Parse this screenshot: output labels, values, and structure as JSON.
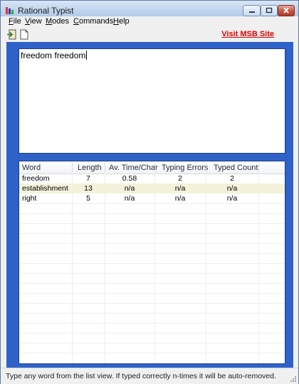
{
  "window": {
    "title": "Rational Typist"
  },
  "menu": {
    "file": {
      "first": "F",
      "rest": "ile"
    },
    "view": {
      "first": "V",
      "rest": "iew"
    },
    "modes": {
      "first": "M",
      "rest": "odes"
    },
    "commands": {
      "first": "C",
      "rest": "ommands"
    },
    "help": {
      "first": "H",
      "rest": "elp"
    }
  },
  "toolbar": {
    "icons": [
      "exit-icon",
      "new-document-icon"
    ],
    "link_label": "Visit MSB Site",
    "link_color": "#e00000"
  },
  "editor": {
    "text": "freedom freedom"
  },
  "list": {
    "columns": [
      "Word",
      "Length",
      "Av. Time/Char",
      "Typing Errors",
      "Typed Count"
    ],
    "rows": [
      [
        "freedom",
        "7",
        "0.58",
        "2",
        "2"
      ],
      [
        "establishment",
        "13",
        "n/a",
        "n/a",
        "n/a"
      ],
      [
        "right",
        "5",
        "n/a",
        "n/a",
        "n/a"
      ]
    ]
  },
  "status": {
    "text": "Type any word from the list view. If typed correctly n-times it will be auto-removed."
  },
  "colors": {
    "accent_panel": "#2f62c8",
    "highlight_row": "#f5f2dc"
  }
}
